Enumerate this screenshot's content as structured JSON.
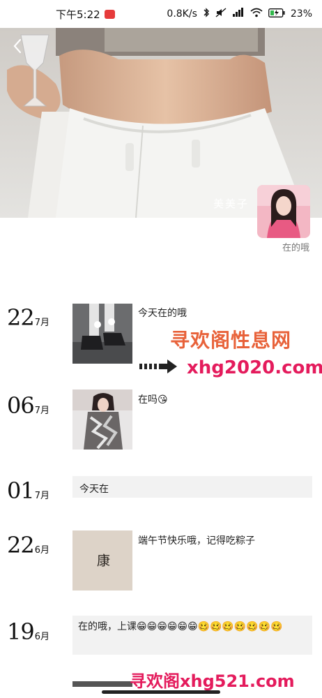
{
  "status_bar": {
    "time": "下午5:22",
    "network_speed": "0.8K/s",
    "battery": "23%"
  },
  "profile": {
    "nickname": "美美子",
    "signature": "在的哦"
  },
  "posts": [
    {
      "day": "22",
      "month": "7月",
      "text": "今天在的哦",
      "type": "image-text"
    },
    {
      "day": "06",
      "month": "7月",
      "text": "在吗😘",
      "type": "image-text"
    },
    {
      "day": "01",
      "month": "7月",
      "text": "今天在",
      "type": "text"
    },
    {
      "day": "22",
      "month": "6月",
      "text": "端午节快乐哦，记得吃粽子",
      "type": "image-text",
      "image_text": "端午安康"
    },
    {
      "day": "19",
      "month": "6月",
      "text": "在的哦，上课😁😁😁😁😁😁🥴🥴🥴🥴🥴🥴🥴",
      "type": "text"
    }
  ],
  "watermarks": {
    "site_name": "寻欢阁性息网",
    "site_url": "xhg2020.com",
    "bottom": "寻欢阁xhg521.com"
  },
  "icons": {
    "back": "chevron-left-icon",
    "bluetooth": "bluetooth-icon",
    "mute": "mute-icon",
    "signal": "signal-icon",
    "wifi": "wifi-icon",
    "battery": "battery-icon"
  },
  "colors": {
    "watermark_orange": "#e8623a",
    "watermark_pink": "#e41b5c",
    "text_box_bg": "#f2f2f2"
  }
}
